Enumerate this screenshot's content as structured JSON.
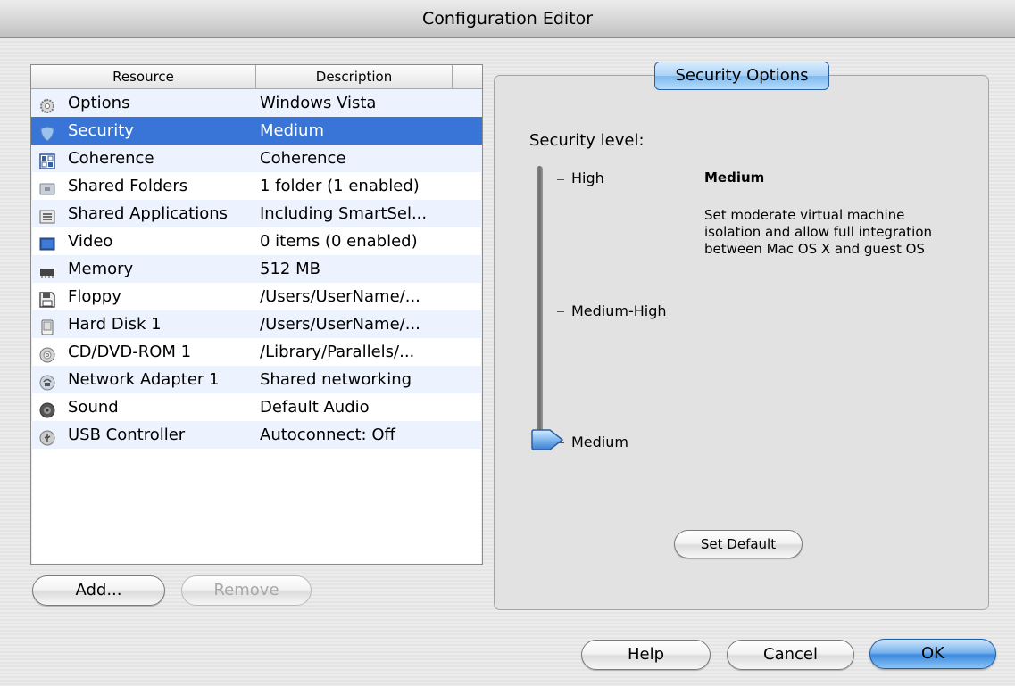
{
  "window": {
    "title": "Configuration Editor"
  },
  "resource_list": {
    "columns": [
      "Resource",
      "Description"
    ],
    "selected_index": 1,
    "rows": [
      {
        "name": "Options",
        "description": "Windows Vista",
        "icon": "gear-icon"
      },
      {
        "name": "Security",
        "description": "Medium",
        "icon": "shield-icon"
      },
      {
        "name": "Coherence",
        "description": "Coherence",
        "icon": "coherence-icon"
      },
      {
        "name": "Shared Folders",
        "description": "1 folder (1 enabled)",
        "icon": "folder-icon"
      },
      {
        "name": "Shared Applications",
        "description": "Including SmartSel...",
        "icon": "applications-icon"
      },
      {
        "name": "Video",
        "description": "0 items (0 enabled)",
        "icon": "monitor-icon"
      },
      {
        "name": "Memory",
        "description": "512 MB",
        "icon": "memory-chip-icon"
      },
      {
        "name": "Floppy",
        "description": "/Users/UserName/...",
        "icon": "floppy-disk-icon"
      },
      {
        "name": "Hard Disk 1",
        "description": "/Users/UserName/...",
        "icon": "hard-disk-icon"
      },
      {
        "name": "CD/DVD-ROM 1",
        "description": "/Library/Parallels/...",
        "icon": "cd-icon"
      },
      {
        "name": "Network Adapter 1",
        "description": "Shared networking",
        "icon": "network-icon"
      },
      {
        "name": "Sound",
        "description": "Default Audio",
        "icon": "speaker-icon"
      },
      {
        "name": "USB Controller",
        "description": "Autoconnect: Off",
        "icon": "usb-icon"
      }
    ]
  },
  "list_buttons": {
    "add": "Add...",
    "remove": "Remove"
  },
  "security": {
    "group_title": "Security Options",
    "label": "Security level:",
    "levels": [
      "High",
      "Medium-High",
      "Medium"
    ],
    "current_level": "Medium",
    "current_level_index": 2,
    "description_title": "Medium",
    "description": "Set moderate virtual machine isolation and allow full integration between Mac OS X and guest OS",
    "set_default": "Set Default"
  },
  "dialog_buttons": {
    "help": "Help",
    "cancel": "Cancel",
    "ok": "OK"
  },
  "colors": {
    "selection": "#3875d7",
    "alt_row": "#edf3fe",
    "default_button": "#3c8ae0"
  }
}
